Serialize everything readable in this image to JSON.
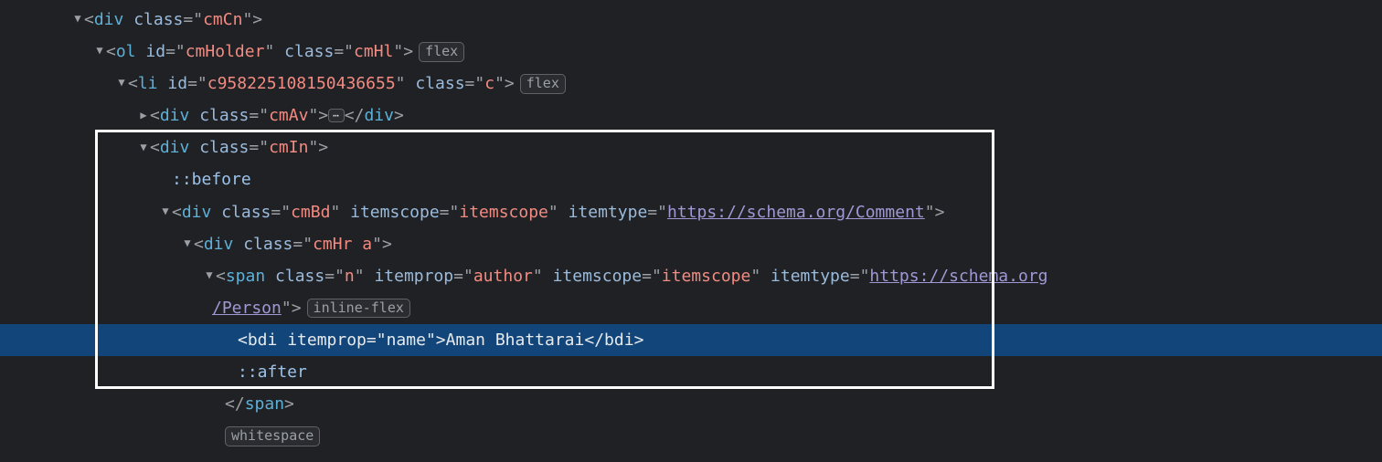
{
  "lines": {
    "l1": {
      "tag": "div",
      "class_attr": "class",
      "class_val": "cmCn"
    },
    "l2": {
      "tag": "ol",
      "id_attr": "id",
      "id_val": "cmHolder",
      "class_attr": "class",
      "class_val": "cmHl",
      "pill": "flex"
    },
    "l3": {
      "tag": "li",
      "id_attr": "id",
      "id_val": "c958225108150436655",
      "class_attr": "class",
      "class_val": "c",
      "pill": "flex"
    },
    "l4": {
      "tag": "div",
      "class_attr": "class",
      "class_val": "cmAv",
      "ell": "⋯",
      "close": "div"
    },
    "l5": {
      "tag": "div",
      "class_attr": "class",
      "class_val": "cmIn"
    },
    "l6": {
      "pseudo": "::before"
    },
    "l7": {
      "tag": "div",
      "class_attr": "class",
      "class_val": "cmBd",
      "a2": "itemscope",
      "v2": "itemscope",
      "a3": "itemtype",
      "v3_link": "https://schema.org/Comment"
    },
    "l8": {
      "tag": "div",
      "class_attr": "class",
      "class_val": "cmHr a"
    },
    "l9": {
      "tag": "span",
      "class_attr": "class",
      "class_val": "n",
      "a2": "itemprop",
      "v2": "author",
      "a3": "itemscope",
      "v3": "itemscope",
      "a4": "itemtype",
      "v4_link_a": "https://schema.org",
      "cont": "/Person",
      "pill": "inline-flex"
    },
    "l10": {
      "tag": "bdi",
      "a1": "itemprop",
      "v1": "name",
      "text": "Aman Bhattarai",
      "close": "bdi"
    },
    "l11": {
      "pseudo": "::after"
    },
    "l12": {
      "close": "span"
    },
    "l13": {
      "pill": "whitespace"
    }
  }
}
